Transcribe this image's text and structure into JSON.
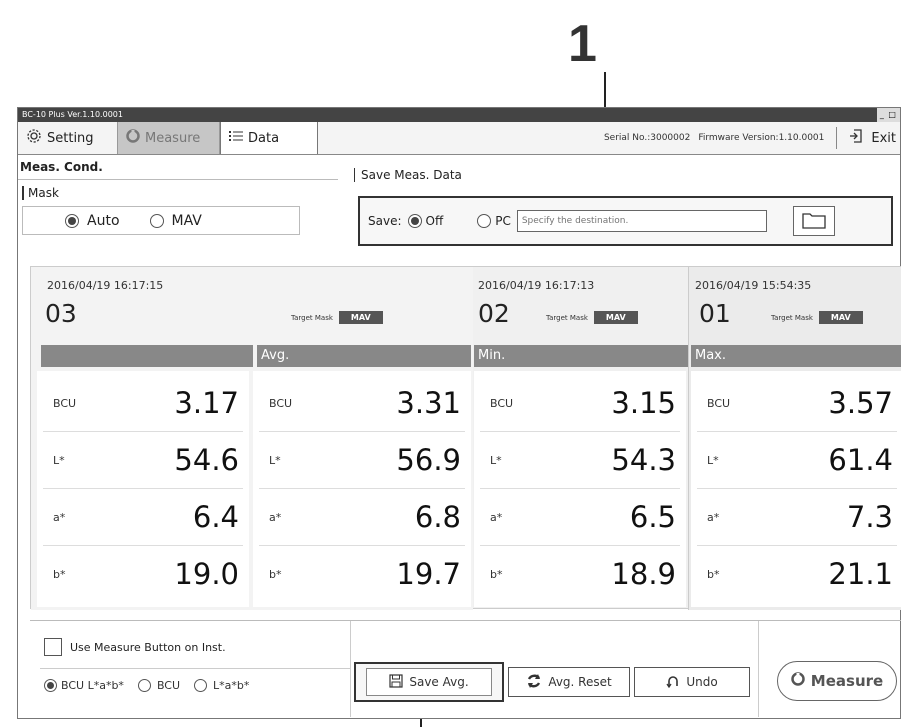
{
  "callout": {
    "label": "1"
  },
  "window": {
    "title": "BC-10 Plus Ver.1.10.0001",
    "controls": "_ □"
  },
  "toolbar": {
    "tabs": [
      {
        "label": "Setting",
        "icon": "gear-icon"
      },
      {
        "label": "Measure",
        "icon": "measure-icon"
      },
      {
        "label": "Data",
        "icon": "list-icon"
      }
    ],
    "serial": "Serial No.:3000002",
    "firmware": "Firmware Version:1.10.0001",
    "exit_label": "Exit"
  },
  "meas_cond": {
    "title": "Meas. Cond.",
    "mask_label": "Mask",
    "options": [
      "Auto",
      "MAV"
    ],
    "selected": "Auto"
  },
  "save_meas": {
    "title": "Save Meas. Data",
    "save_label": "Save:",
    "options": [
      "Off",
      "PC"
    ],
    "selected": "Off",
    "destination_placeholder": "Specify the destination."
  },
  "measurements": [
    {
      "datetime": "2016/04/19 16:17:15",
      "number": "03",
      "target_mask_label": "Target Mask",
      "target_mask": "MAV",
      "header": "",
      "values": [
        {
          "label": "BCU",
          "value": "3.17"
        },
        {
          "label": "L*",
          "value": "54.6"
        },
        {
          "label": "a*",
          "value": "6.4"
        },
        {
          "label": "b*",
          "value": "19.0"
        }
      ]
    },
    {
      "datetime": "2016/04/19 16:17:13",
      "number": "02",
      "target_mask_label": "Target Mask",
      "target_mask": "MAV",
      "header": "Min.",
      "values": [
        {
          "label": "BCU",
          "value": "3.15"
        },
        {
          "label": "L*",
          "value": "54.3"
        },
        {
          "label": "a*",
          "value": "6.5"
        },
        {
          "label": "b*",
          "value": "18.9"
        }
      ]
    },
    {
      "datetime": "2016/04/19 15:54:35",
      "number": "01",
      "target_mask_label": "Target Mask",
      "target_mask": "MAV",
      "header": "Max.",
      "values": [
        {
          "label": "BCU",
          "value": "3.57"
        },
        {
          "label": "L*",
          "value": "61.4"
        },
        {
          "label": "a*",
          "value": "7.3"
        },
        {
          "label": "b*",
          "value": "21.1"
        }
      ]
    }
  ],
  "average": {
    "header": "Avg.",
    "values": [
      {
        "label": "BCU",
        "value": "3.31"
      },
      {
        "label": "L*",
        "value": "56.9"
      },
      {
        "label": "a*",
        "value": "6.8"
      },
      {
        "label": "b*",
        "value": "19.7"
      }
    ]
  },
  "bottom": {
    "use_button_label": "Use Measure Button on Inst.",
    "display_modes": [
      "BCU L*a*b*",
      "BCU",
      "L*a*b*"
    ],
    "selected_mode": "BCU L*a*b*",
    "save_avg_label": "Save Avg.",
    "avg_reset_label": "Avg. Reset",
    "undo_label": "Undo",
    "measure_label": "Measure"
  }
}
